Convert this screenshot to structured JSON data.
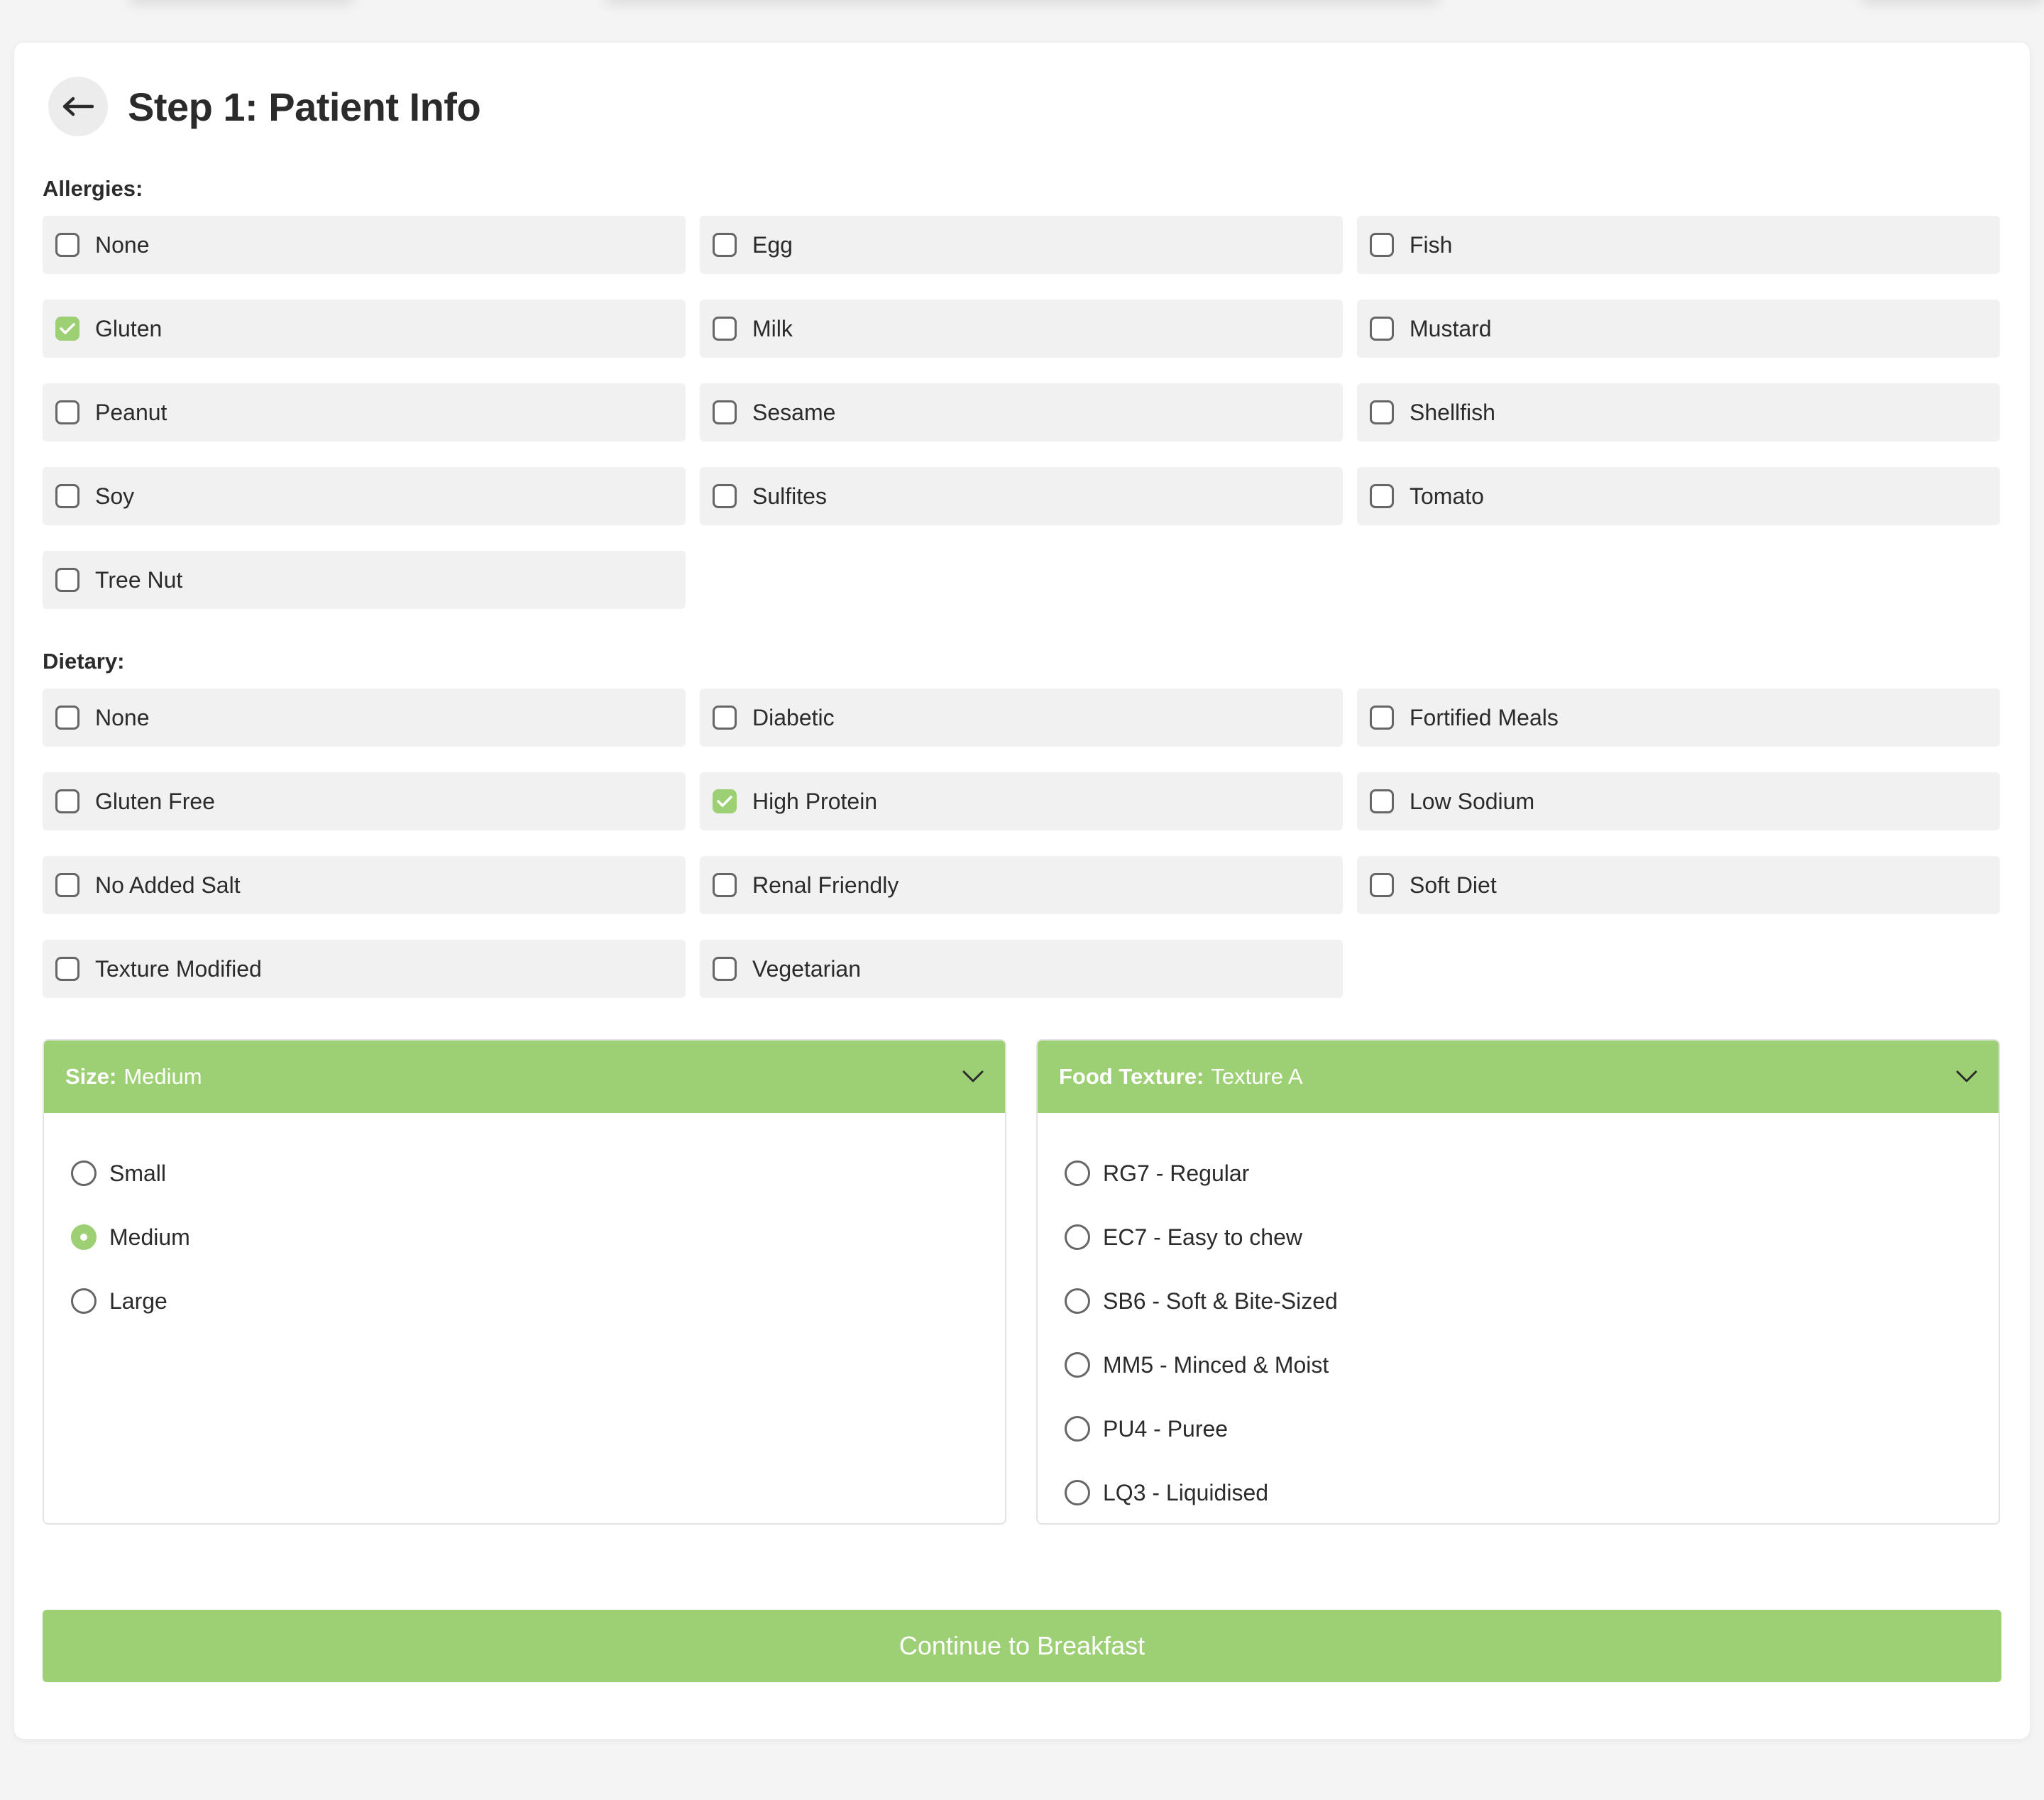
{
  "header": {
    "title": "Step 1: Patient Info"
  },
  "allergies": {
    "label": "Allergies:",
    "options": [
      {
        "label": "None",
        "checked": false
      },
      {
        "label": "Egg",
        "checked": false
      },
      {
        "label": "Fish",
        "checked": false
      },
      {
        "label": "Gluten",
        "checked": true
      },
      {
        "label": "Milk",
        "checked": false
      },
      {
        "label": "Mustard",
        "checked": false
      },
      {
        "label": "Peanut",
        "checked": false
      },
      {
        "label": "Sesame",
        "checked": false
      },
      {
        "label": "Shellfish",
        "checked": false
      },
      {
        "label": "Soy",
        "checked": false
      },
      {
        "label": "Sulfites",
        "checked": false
      },
      {
        "label": "Tomato",
        "checked": false
      },
      {
        "label": "Tree Nut",
        "checked": false
      }
    ]
  },
  "dietary": {
    "label": "Dietary:",
    "options": [
      {
        "label": "None",
        "checked": false
      },
      {
        "label": "Diabetic",
        "checked": false
      },
      {
        "label": "Fortified Meals",
        "checked": false
      },
      {
        "label": "Gluten Free",
        "checked": false
      },
      {
        "label": "High Protein",
        "checked": true
      },
      {
        "label": "Low Sodium",
        "checked": false
      },
      {
        "label": "No Added Salt",
        "checked": false
      },
      {
        "label": "Renal Friendly",
        "checked": false
      },
      {
        "label": "Soft Diet",
        "checked": false
      },
      {
        "label": "Texture Modified",
        "checked": false
      },
      {
        "label": "Vegetarian",
        "checked": false
      }
    ]
  },
  "size": {
    "label": "Size:",
    "value": "Medium",
    "options": [
      {
        "label": "Small",
        "selected": false
      },
      {
        "label": "Medium",
        "selected": true
      },
      {
        "label": "Large",
        "selected": false
      }
    ]
  },
  "texture": {
    "label": "Food Texture:",
    "value": "Texture A",
    "options": [
      {
        "label": "RG7 - Regular",
        "selected": false
      },
      {
        "label": "EC7 - Easy to chew",
        "selected": false
      },
      {
        "label": "SB6 - Soft & Bite-Sized",
        "selected": false
      },
      {
        "label": "MM5 - Minced & Moist",
        "selected": false
      },
      {
        "label": "PU4 - Puree",
        "selected": false
      },
      {
        "label": "LQ3 - Liquidised",
        "selected": false
      }
    ]
  },
  "actions": {
    "continue_label": "Continue to Breakfast"
  },
  "colors": {
    "accent": "#9dcf74",
    "option_bg": "#f1f1f1",
    "text": "#2b2b2b"
  },
  "icons": {
    "back": "arrow-left-icon",
    "chevron": "chevron-down-icon",
    "check": "checkmark-icon"
  }
}
